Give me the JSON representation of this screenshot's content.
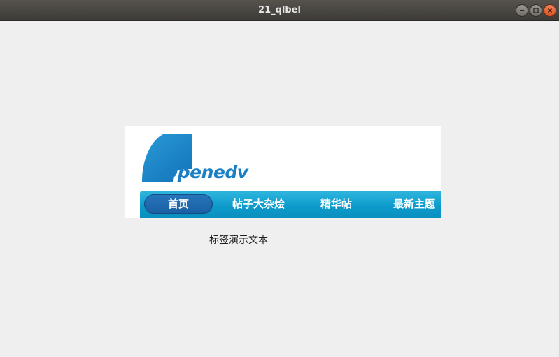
{
  "window": {
    "title": "21_qlbel",
    "controls": {
      "minimize": "minimize-icon",
      "maximize": "maximize-icon",
      "close": "close-icon"
    }
  },
  "banner": {
    "logo_text": "Openedv",
    "nav_items": [
      "首页",
      "帖子大杂烩",
      "精华帖",
      "最新主题"
    ]
  },
  "label": {
    "text": "标签演示文本"
  },
  "colors": {
    "title_bar": "#45423d",
    "close_button": "#e0602b",
    "nav_bar": "#0c9acb",
    "nav_active": "#1f69ae",
    "logo_blue": "#1a7fc4"
  }
}
